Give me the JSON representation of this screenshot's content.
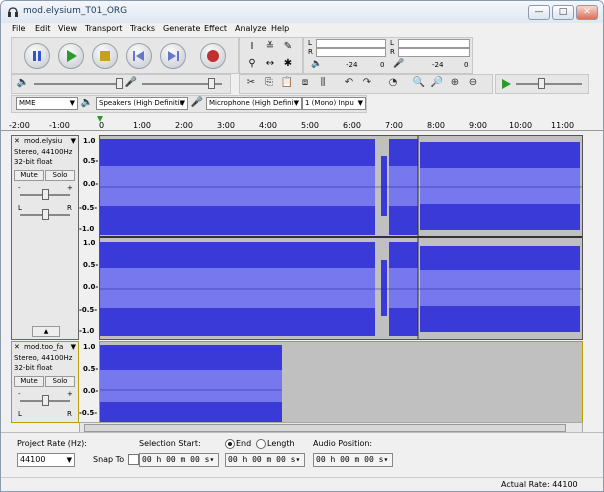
{
  "window": {
    "title": "mod.elysium_T01_ORG",
    "min": "—",
    "max": "□",
    "close": "✕"
  },
  "menu": [
    "File",
    "Edit",
    "View",
    "Transport",
    "Tracks",
    "Generate",
    "Effect",
    "Analyze",
    "Help"
  ],
  "meters": {
    "L": "L",
    "R": "R",
    "ticks_play": [
      "-24",
      "0"
    ],
    "ticks_rec": [
      "-24",
      "0"
    ]
  },
  "devices": {
    "host": "MME",
    "speakers": "Speakers (High Definitio",
    "microphone": "Microphone (High Defini",
    "channels": "1 (Mono) Inpu"
  },
  "ruler": [
    "-2:00",
    "-1:00",
    "0",
    "1:00",
    "2:00",
    "3:00",
    "4:00",
    "5:00",
    "6:00",
    "7:00",
    "8:00",
    "9:00",
    "10:00",
    "11:00"
  ],
  "track1": {
    "name": "mod.elysiu",
    "info1": "Stereo, 44100Hz",
    "info2": "32-bit float",
    "mute": "Mute",
    "solo": "Solo",
    "L": "L",
    "R": "R",
    "minus": "-",
    "plus": "+",
    "scale_top": [
      "1.0",
      "0.5-",
      "0.0-",
      "-0.5-",
      "-1.0"
    ],
    "scale_bot": [
      "1.0",
      "0.5-",
      "0.0-",
      "-0.5-",
      "-1.0"
    ]
  },
  "track2": {
    "name": "mod.too_fa",
    "info1": "Stereo, 44100Hz",
    "info2": "32-bit float",
    "mute": "Mute",
    "solo": "Solo",
    "L": "L",
    "R": "R",
    "minus": "-",
    "plus": "+",
    "scale": [
      "1.0",
      "0.5-",
      "0.0-",
      "-0.5-"
    ]
  },
  "bottom": {
    "rate_label": "Project Rate (Hz):",
    "rate": "44100",
    "snap": "Snap To",
    "sel_label": "Selection Start:",
    "end": "End",
    "length": "Length",
    "pos_label": "Audio Position:",
    "time1": "00 h 00 m 00 s",
    "time2": "00 h 00 m 00 s",
    "time3": "00 h 00 m 00 s"
  },
  "status": {
    "rate": "Actual Rate: 44100"
  },
  "colors": {
    "wave": "#3a3ad8",
    "wave_light": "#7777ee",
    "bg": "#f0f0f0"
  }
}
